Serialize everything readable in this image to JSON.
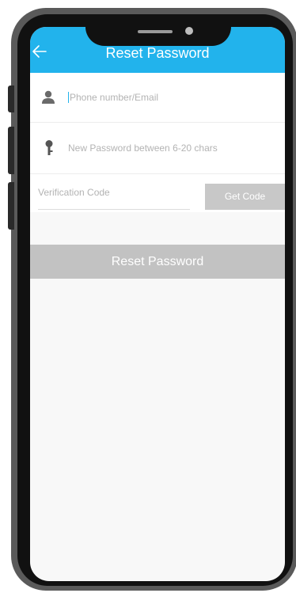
{
  "header": {
    "title": "Reset Password",
    "accent_color": "#22b3ec",
    "back_icon": "arrow-left-icon"
  },
  "form": {
    "account": {
      "icon": "user-icon",
      "placeholder": "Phone number/Email",
      "value": ""
    },
    "password": {
      "icon": "key-icon",
      "placeholder": "New Password between 6-20 chars",
      "value": ""
    },
    "code": {
      "placeholder": "Verification Code",
      "value": "",
      "get_code_label": "Get Code"
    },
    "submit_label": "Reset Password"
  },
  "colors": {
    "button_disabled": "#c2c2c2",
    "screen_background": "#f8f8f8"
  }
}
